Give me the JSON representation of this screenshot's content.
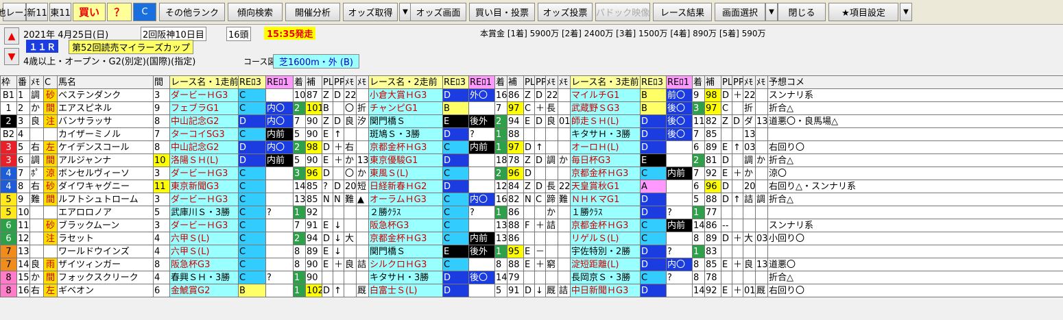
{
  "toolbar": {
    "buttons": [
      "他レース",
      "新11",
      "東11",
      "買い",
      "？",
      "C",
      "その他ランク",
      "傾向検索",
      "開催分析",
      "オッズ取得",
      "オッズ画面",
      "買い目・投票",
      "オッズ投票",
      "パドック映像",
      "レース結果",
      "画面選択",
      "閉じる",
      "★項目設定"
    ]
  },
  "race": {
    "date": "2021年 4月25日(日)",
    "meeting": "2回阪神10日目",
    "heads": "16頭",
    "post_time": "15:35発走",
    "race_no": "１１Ｒ",
    "name": "第52回読売マイラーズカップ",
    "conditions": "4歳以上・オープン・G2(別定)(国際)(指定)",
    "course_label": "コース図",
    "course": "芝1600m・外 (B)",
    "prize": "本賞金 [1着] 5900万 [2着] 2400万 [3着] 1500万 [4着] 890万 [5着] 590万"
  },
  "headers": [
    "枠",
    "番",
    "ﾒﾓ",
    "C",
    "馬名",
    "間",
    "レース名・1走前",
    "REﾛ3",
    "REﾛ1",
    "着",
    "補",
    "PL",
    "PP",
    "ﾒﾓ",
    "ﾒﾓ",
    "レース名・2走前",
    "REﾛ3",
    "REﾛ1",
    "着",
    "補",
    "PL",
    "PP",
    "ﾒﾓ",
    "ﾒﾓ",
    "レース名・3走前",
    "REﾛ3",
    "REﾛ1",
    "着",
    "補",
    "PL",
    "PP",
    "ﾒﾓ",
    "ﾒﾓ",
    "予想コメ"
  ],
  "rows": [
    [
      "B1",
      "1",
      "調",
      "砂",
      "ベステンダンク",
      "3",
      "ダービーＨG3",
      "C",
      "",
      "10",
      "87",
      "Z",
      "D",
      "22",
      "",
      "小倉大賞ＨG3",
      "D",
      "外〇",
      "16",
      "86",
      "Z",
      "D",
      "22",
      "",
      "マイルチG1",
      "B",
      "前〇",
      "9",
      "98",
      "D",
      "＋",
      "22",
      "",
      "スンナリ系"
    ],
    [
      "1",
      "2",
      "か",
      "間",
      "エアスピネル",
      "9",
      "フェブラG1",
      "C",
      "内〇",
      "2",
      "101",
      "B",
      "",
      "〇",
      "折",
      "チャンピG1",
      "B",
      "",
      "7",
      "97",
      "C",
      "＋",
      "長",
      "",
      "武蔵野ＳG3",
      "B",
      "後〇",
      "3",
      "97",
      "C",
      "",
      "折",
      "",
      "折合△"
    ],
    [
      "2",
      "3",
      "良",
      "注",
      "バンサラッサ",
      "8",
      "中山記念G2",
      "D",
      "内〇",
      "7",
      "90",
      "Z",
      "D",
      "良",
      "汐",
      "関門橋Ｓ",
      "E",
      "後外",
      "2",
      "94",
      "E",
      "D",
      "良",
      "01",
      "師走ＳＨ(L)",
      "D",
      "後〇",
      "11",
      "82",
      "Z",
      "D",
      "ダ",
      "13",
      "道悪〇・良馬場△"
    ],
    [
      "B2",
      "4",
      "",
      "",
      "カイザーミノル",
      "7",
      "ターコイSG3",
      "C",
      "内前",
      "5",
      "90",
      "E",
      "↑",
      "",
      "",
      "斑鳩Ｓ・3勝",
      "D",
      "?",
      "1",
      "88",
      "",
      "",
      "",
      "",
      "キタサＨ・3勝",
      "D",
      "後〇",
      "7",
      "85",
      "",
      "",
      "13",
      "",
      ""
    ],
    [
      "3",
      "5",
      "右",
      "左",
      "ケイデンスコール",
      "8",
      "中山記念G2",
      "D",
      "内〇",
      "2",
      "98",
      "D",
      "＋",
      "右",
      "",
      "京都金杯ＨG3",
      "C",
      "内前",
      "1",
      "97",
      "D",
      "↑",
      "",
      "",
      "オーロＨ(L)",
      "D",
      "",
      "6",
      "89",
      "E",
      "↑",
      "03",
      "",
      "右回り〇"
    ],
    [
      "3",
      "6",
      "調",
      "間",
      "アルジャンナ",
      "10",
      "洛陽ＳＨ(L)",
      "D",
      "内前",
      "5",
      "90",
      "E",
      "＋",
      "か",
      "13",
      "東京優駿G1",
      "D",
      "",
      "18",
      "78",
      "Z",
      "D",
      "調",
      "か",
      "毎日杯G3",
      "E",
      "",
      "2",
      "81",
      "D",
      "",
      "調",
      "か",
      "折合△"
    ],
    [
      "4",
      "7",
      "ﾎﾟ",
      "涼",
      "ボンセルヴィーソ",
      "3",
      "ダービーＨG3",
      "C",
      "",
      "3",
      "96",
      "D",
      "",
      "〇",
      "か",
      "東風Ｓ(L)",
      "C",
      "",
      "2",
      "96",
      "D",
      "",
      "",
      "",
      "京都金杯ＨG3",
      "C",
      "内前",
      "7",
      "92",
      "E",
      "＋",
      "か",
      "",
      "涼〇"
    ],
    [
      "4",
      "8",
      "右",
      "砂",
      "ダイワキャグニー",
      "11",
      "東京新聞G3",
      "C",
      "",
      "14",
      "85",
      "?",
      "D",
      "20",
      "短",
      "日経新春ＨG2",
      "D",
      "",
      "12",
      "84",
      "Z",
      "D",
      "長",
      "22",
      "天皇賞秋G1",
      "A",
      "",
      "6",
      "96",
      "D",
      "",
      "20",
      "",
      "右回り△・スンナリ系"
    ],
    [
      "5",
      "9",
      "難",
      "間",
      "ルフトシュトローム",
      "3",
      "ダービーＨG3",
      "C",
      "",
      "13",
      "85",
      "N",
      "N",
      "難",
      "▲",
      "オーラムＨG3",
      "C",
      "内〇",
      "16",
      "82",
      "N",
      "C",
      "蹄",
      "難",
      "ＮＨＫマG1",
      "D",
      "",
      "5",
      "88",
      "D",
      "↑",
      "詰",
      "調",
      "折合△"
    ],
    [
      "5",
      "10",
      "",
      "",
      "エアロロノア",
      "5",
      "武庫川Ｓ・3勝",
      "C",
      "?",
      "1",
      "92",
      "",
      "",
      "",
      "",
      "２勝ｸﾗｽ",
      "C",
      "?",
      "1",
      "86",
      "",
      "",
      "か",
      "",
      "１勝ｸﾗｽ",
      "D",
      "?",
      "1",
      "77",
      "",
      "",
      "",
      "",
      ""
    ],
    [
      "6",
      "11",
      "",
      "砂",
      "ブラックムーン",
      "3",
      "ダービーＨG3",
      "C",
      "",
      "7",
      "91",
      "E",
      "↓",
      "",
      "",
      "阪急杯G3",
      "C",
      "",
      "13",
      "88",
      "F",
      "＋",
      "詰",
      "",
      "京都金杯ＨG3",
      "C",
      "内前",
      "14",
      "86",
      "--",
      "",
      "",
      "",
      "スンナリ系"
    ],
    [
      "6",
      "12",
      "",
      "注",
      "ラセット",
      "4",
      "六甲Ｓ(L)",
      "C",
      "",
      "2",
      "94",
      "D",
      "↓",
      "大",
      "",
      "京都金杯ＨG3",
      "C",
      "内前",
      "13",
      "86",
      "",
      "",
      "",
      "",
      "リゲルＳ(L)",
      "C",
      "",
      "8",
      "89",
      "D",
      "＋",
      "大",
      "03",
      "小回り〇"
    ],
    [
      "7",
      "13",
      "",
      "",
      "ワールドウインズ",
      "4",
      "六甲Ｓ(L)",
      "C",
      "",
      "8",
      "89",
      "E",
      "↓",
      "",
      "",
      "関門橋Ｓ",
      "E",
      "後外",
      "1",
      "95",
      "E",
      "－",
      "",
      "",
      "宇佐特別・2勝",
      "D",
      "?",
      "1",
      "83",
      "",
      "",
      "",
      "",
      ""
    ],
    [
      "7",
      "14",
      "良",
      "雨",
      "ザイツィンガー",
      "8",
      "阪急杯G3",
      "C",
      "",
      "8",
      "90",
      "E",
      "＋",
      "良",
      "詰",
      "シルクロＨG3",
      "C",
      "",
      "8",
      "88",
      "E",
      "＋",
      "窮",
      "",
      "淀短距離(L)",
      "D",
      "内〇",
      "8",
      "85",
      "E",
      "＋",
      "良",
      "13",
      "道悪〇"
    ],
    [
      "8",
      "15",
      "か",
      "間",
      "フォックスクリーク",
      "4",
      "春興ＳＨ・3勝",
      "C",
      "?",
      "1",
      "90",
      "",
      "",
      "",
      "",
      "キタサＨ・3勝",
      "D",
      "後〇",
      "14",
      "79",
      "",
      "",
      "",
      "",
      "長岡京Ｓ・3勝",
      "C",
      "?",
      "8",
      "78",
      "",
      "",
      "",
      "",
      "折合△"
    ],
    [
      "8",
      "16",
      "右",
      "左",
      "ギベオン",
      "6",
      "金鯱賞G2",
      "B",
      "",
      "1",
      "102",
      "D",
      "↑",
      "",
      "厩",
      "白富士Ｓ(L)",
      "D",
      "",
      "5",
      "91",
      "D",
      "↓",
      "厩",
      "詰",
      "中日新聞ＨG3",
      "D",
      "",
      "14",
      "92",
      "E",
      "＋",
      "01",
      "厩",
      "右回り〇"
    ]
  ],
  "waku_colors": {
    "1": "#ffffff",
    "2": "#000000",
    "3": "#e8202a",
    "4": "#1e5cd8",
    "5": "#ffe81c",
    "6": "#2ea04a",
    "7": "#f08c1c",
    "8": "#ff7cc8",
    "B1": "#ffffff",
    "B2": "#ffffff"
  },
  "grade_colors": {
    "A": "#ff99ff",
    "B": "#ffff66",
    "C": "#33ccff",
    "D": "#1a3ce0",
    "E": "#000000"
  }
}
